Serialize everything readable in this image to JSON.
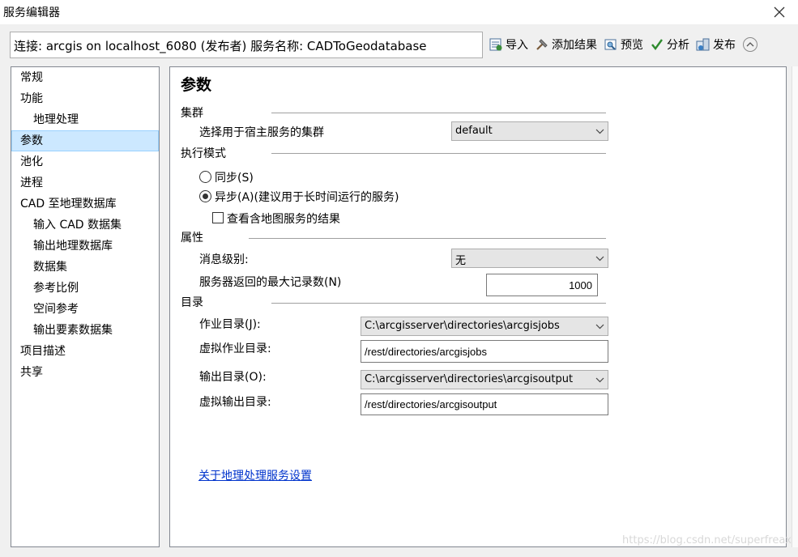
{
  "window": {
    "title": "服务编辑器"
  },
  "connection": {
    "text": "连接: arcgis on localhost_6080 (发布者)   服务名称: CADToGeodatabase"
  },
  "toolbar": {
    "import": "导入",
    "add_result": "添加结果",
    "preview": "预览",
    "analyze": "分析",
    "publish": "发布"
  },
  "sidebar": {
    "items": [
      {
        "label": "常规"
      },
      {
        "label": "功能"
      },
      {
        "label": "地理处理"
      },
      {
        "label": "参数"
      },
      {
        "label": "池化"
      },
      {
        "label": "进程"
      },
      {
        "label": "CAD 至地理数据库"
      },
      {
        "label": "输入 CAD 数据集"
      },
      {
        "label": "输出地理数据库"
      },
      {
        "label": "数据集"
      },
      {
        "label": "参考比例"
      },
      {
        "label": "空间参考"
      },
      {
        "label": "输出要素数据集"
      },
      {
        "label": "项目描述"
      },
      {
        "label": "共享"
      }
    ]
  },
  "panel": {
    "title": "参数",
    "cluster": {
      "heading": "集群",
      "label": "选择用于宿主服务的集群",
      "value": "default"
    },
    "execution": {
      "heading": "执行模式",
      "sync_label": "同步(S)",
      "async_label": "异步(A)(建议用于长时间运行的服务)",
      "view_result_label": "查看含地图服务的结果"
    },
    "properties": {
      "heading": "属性",
      "message_level_label": "消息级别:",
      "message_level_value": "无",
      "max_records_label": "服务器返回的最大记录数(N)",
      "max_records_value": "1000"
    },
    "directories": {
      "heading": "目录",
      "jobs_label": "作业目录(J):",
      "jobs_value": "C:\\arcgisserver\\directories\\arcgisjobs",
      "virtual_jobs_label": "虚拟作业目录:",
      "virtual_jobs_value": "/rest/directories/arcgisjobs",
      "output_label": "输出目录(O):",
      "output_value": "C:\\arcgisserver\\directories\\arcgisoutput",
      "virtual_output_label": "虚拟输出目录:",
      "virtual_output_value": "/rest/directories/arcgisoutput"
    },
    "help_link": "关于地理处理服务设置"
  },
  "watermark": "https://blog.csdn.net/superfreax"
}
